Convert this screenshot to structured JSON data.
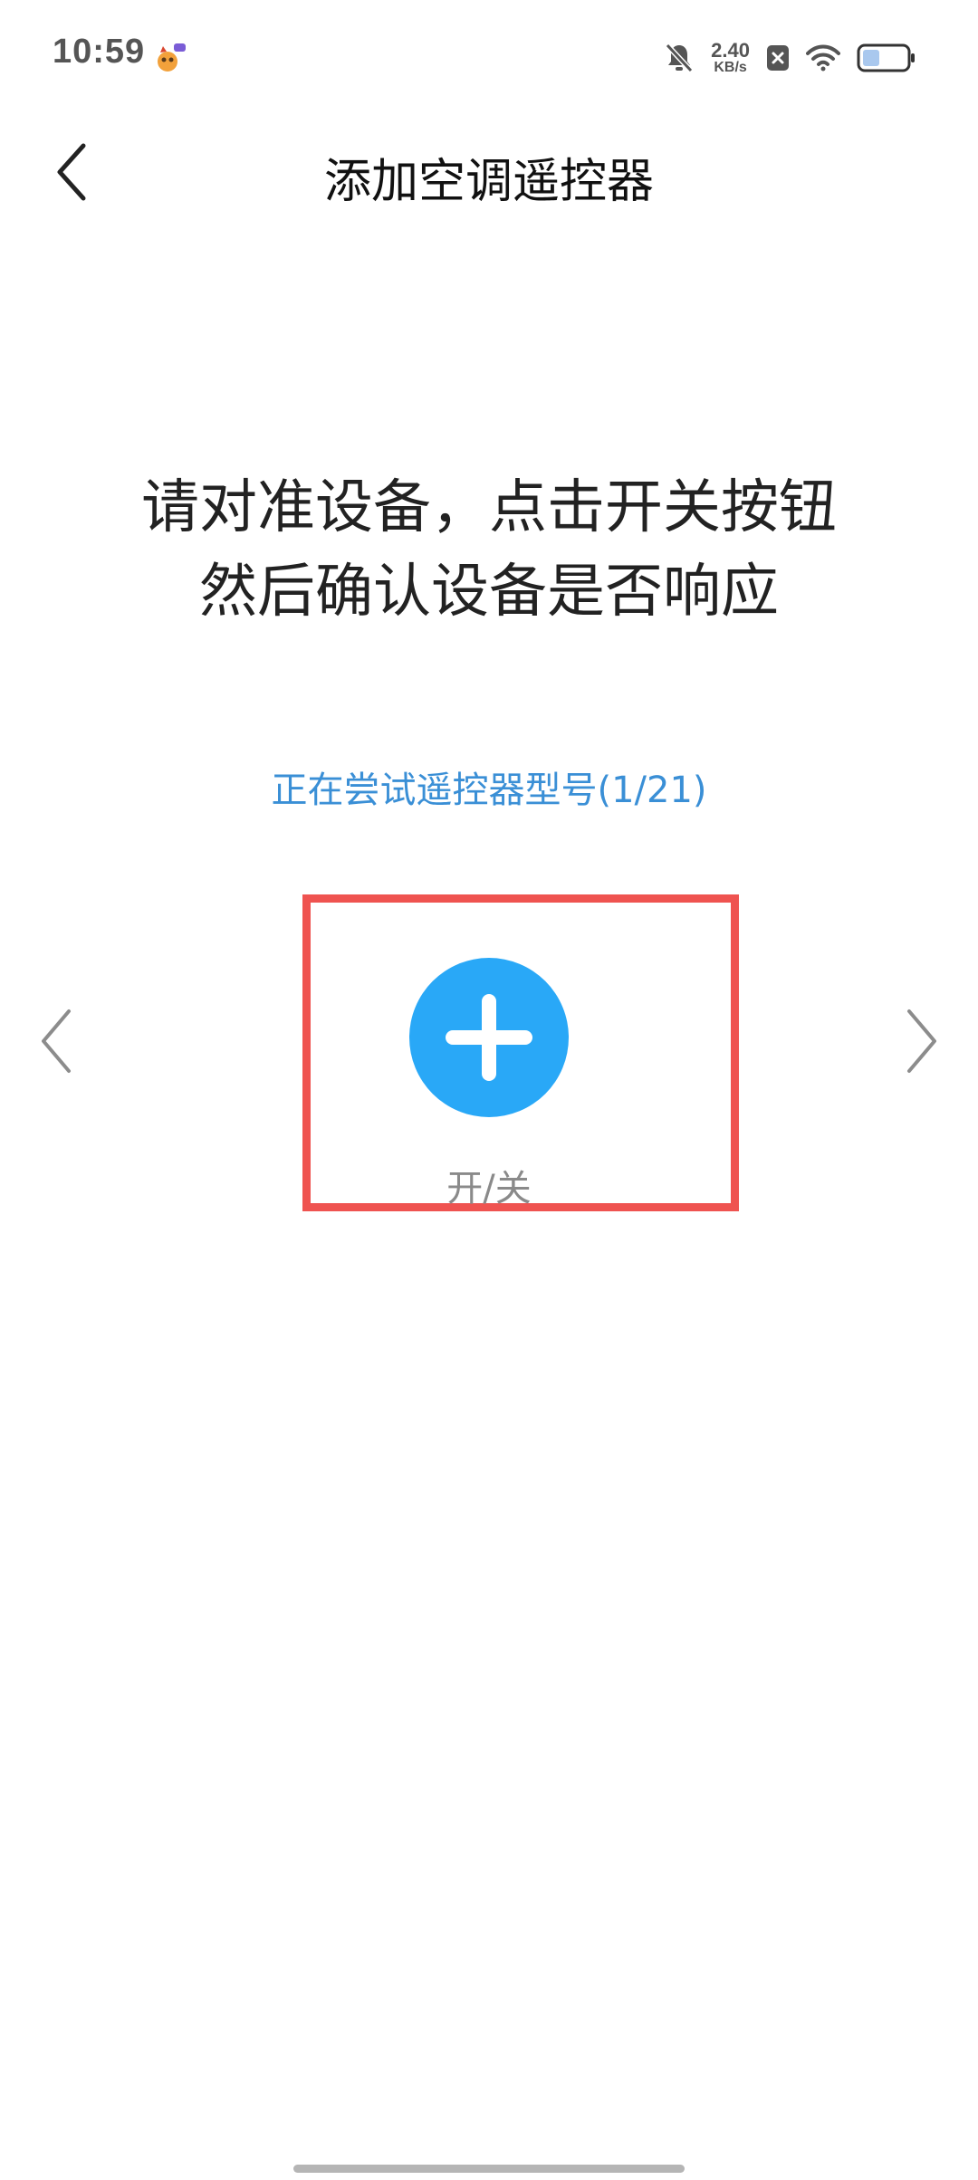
{
  "status_bar": {
    "time": "10:59",
    "net_speed_value": "2.40",
    "net_speed_unit": "KB/s",
    "battery_level_fraction": 0.4,
    "icons": [
      "app-notification-icon",
      "mute-icon",
      "x-icon",
      "wifi-icon",
      "battery-icon"
    ]
  },
  "header": {
    "title": "添加空调遥控器",
    "back_icon": "chevron-left-icon"
  },
  "instruction": {
    "line1": "请对准设备，点击开关按钮",
    "line2": "然后确认设备是否响应"
  },
  "trying_model": "正在尝试遥控器型号(1/21)",
  "carousel": {
    "prev_icon": "chevron-left-icon",
    "next_icon": "chevron-right-icon"
  },
  "power_key": {
    "label": "开/关",
    "icon": "plus-icon"
  },
  "colors": {
    "accent_blue": "#29a8f7",
    "link_blue": "#3a8fd6",
    "highlight_red": "#ef5350",
    "label_gray": "#8a8a8a"
  }
}
